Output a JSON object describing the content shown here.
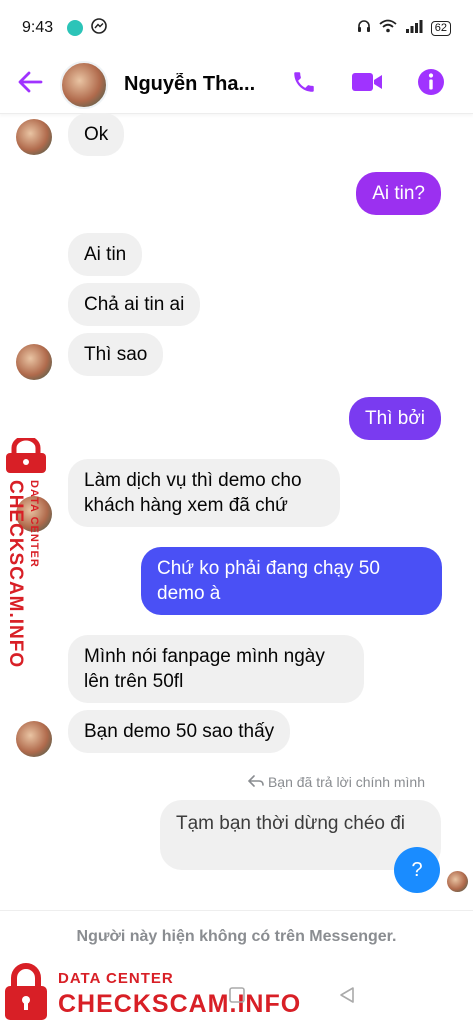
{
  "status_bar": {
    "time": "9:43",
    "battery": "62"
  },
  "header": {
    "contact_name": "Nguyễn Tha...",
    "icons": [
      "back-arrow-icon",
      "phone-icon",
      "video-icon",
      "info-icon"
    ],
    "accent_color": "#a033ff"
  },
  "messages": [
    {
      "side": "in",
      "text": "Ok"
    },
    {
      "side": "out",
      "text": "Ai tin?"
    },
    {
      "side": "in",
      "text": "Ai tin"
    },
    {
      "side": "in",
      "text": "Chả ai tin ai"
    },
    {
      "side": "in",
      "text": "Thì sao"
    },
    {
      "side": "out",
      "text": "Thì bởi"
    },
    {
      "side": "in",
      "text": "Làm dịch vụ thì demo cho khách hàng xem đã chứ"
    },
    {
      "side": "out",
      "text": "Chứ ko phải đang chạy 50 demo à"
    },
    {
      "side": "in",
      "text": "Mình nói fanpage mình ngày lên trên 50fl"
    },
    {
      "side": "in",
      "text": "Bạn demo 50 sao thấy"
    },
    {
      "side": "out_unsent",
      "text": "Tạm bạn thời dừng chéo đi"
    }
  ],
  "reply_note": "Bạn đã trả lời chính mình",
  "help_button": "?",
  "footer": {
    "unavailable": "Người này hiện không có trên Messenger."
  },
  "watermark": {
    "small": "DATA CENTER",
    "big": "CHECKSCAM.INFO",
    "color": "#d81f26"
  }
}
